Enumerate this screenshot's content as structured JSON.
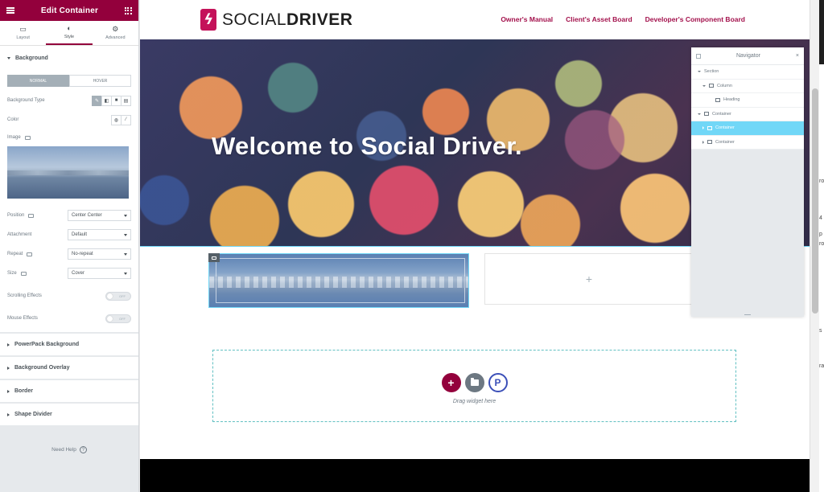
{
  "panel": {
    "title": "Edit Container",
    "tabs": [
      {
        "label": "Layout",
        "icon": "layout-icon"
      },
      {
        "label": "Style",
        "icon": "half-circle-icon"
      },
      {
        "label": "Advanced",
        "icon": "gear-icon"
      }
    ],
    "background_section": {
      "title": "Background",
      "state_tabs": [
        "NORMAL",
        "HOVER"
      ],
      "background_type_label": "Background Type",
      "color_label": "Color",
      "image_label": "Image",
      "position_label": "Position",
      "position_value": "Center Center",
      "attachment_label": "Attachment",
      "attachment_value": "Default",
      "repeat_label": "Repeat",
      "repeat_value": "No-repeat",
      "size_label": "Size",
      "size_value": "Cover",
      "scrolling_effects_label": "Scrolling Effects",
      "mouse_effects_label": "Mouse Effects",
      "toggle_off_text": "OFF"
    },
    "collapsed_sections": [
      "PowerPack Background",
      "Background Overlay",
      "Border",
      "Shape Divider"
    ],
    "need_help": "Need Help",
    "accent_color": "#93003c"
  },
  "site": {
    "logo_prefix": "SOCIAL",
    "logo_bold": "DRIVER",
    "nav": [
      "Owner's Manual",
      "Client's Asset Board",
      "Developer's Component Board"
    ],
    "hero_title": "Welcome to Social Driver.",
    "empty_column_plus": "+",
    "drop_text": "Drag widget here",
    "add_symbol": "+",
    "powerpack_letter": "P"
  },
  "navigator": {
    "title": "Navigator",
    "close_symbol": "×",
    "items": [
      {
        "label": "Section",
        "level": 0,
        "selected": false
      },
      {
        "label": "Column",
        "level": 1,
        "selected": false
      },
      {
        "label": "Heading",
        "level": 2,
        "selected": false
      },
      {
        "label": "Container",
        "level": 0,
        "selected": false
      },
      {
        "label": "Container",
        "level": 1,
        "selected": true
      },
      {
        "label": "Container",
        "level": 1,
        "selected": false
      }
    ]
  },
  "right_edge_fragments": [
    "ro",
    "4",
    "p",
    "ro",
    "s",
    "ra"
  ]
}
